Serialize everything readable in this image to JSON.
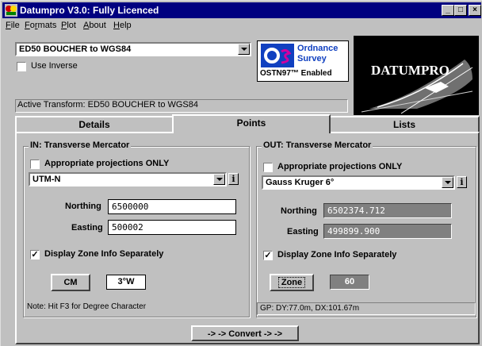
{
  "window": {
    "title": "Datumpro V3.0: Fully Licenced",
    "controls": {
      "minimize": "_",
      "maximize": "□",
      "close": "×"
    }
  },
  "menu": [
    "File",
    "Formats",
    "Plot",
    "About",
    "Help"
  ],
  "transform_select": {
    "value": "ED50 BOUCHER to WGS84"
  },
  "use_inverse": {
    "label": "Use Inverse",
    "checked": false
  },
  "os_logo": {
    "line1": "Ordnance",
    "line2": "Survey",
    "badge": "OSTN97™ Enabled",
    "colors": {
      "blue": "#1040c0",
      "magenta": "#d000a0"
    }
  },
  "datumpro_logo": {
    "text": "DATUMPRO"
  },
  "active_transform": "Active Transform: ED50 BOUCHER to WGS84",
  "tabs": [
    {
      "label": "Details",
      "active": false
    },
    {
      "label": "Points",
      "active": true
    },
    {
      "label": "Lists",
      "active": false
    }
  ],
  "input": {
    "group_title": "IN: Transverse Mercator",
    "appropriate_only": {
      "label": "Appropriate projections ONLY",
      "checked": false
    },
    "projection": "UTM-N",
    "info_button": "i",
    "northing": {
      "label": "Northing",
      "value": "6500000"
    },
    "easting": {
      "label": "Easting",
      "value": "500002"
    },
    "zone_separate": {
      "label": "Display  Zone Info Separately",
      "checked": true,
      "mark": "✓"
    },
    "cm_button": "CM",
    "cm_value": "3°W",
    "note": "Note: Hit F3 for Degree Character"
  },
  "output": {
    "group_title": "OUT: Transverse Mercator",
    "appropriate_only": {
      "label": "Appropriate projections ONLY",
      "checked": false
    },
    "projection": "Gauss Kruger 6°",
    "info_button": "i",
    "northing": {
      "label": "Northing",
      "value": "6502374.712"
    },
    "easting": {
      "label": "Easting",
      "value": "499899.900"
    },
    "zone_separate": {
      "label": "Display  Zone Info Separately",
      "checked": true,
      "mark": "✓"
    },
    "zone_button": "Zone",
    "zone_value": "60",
    "status": "GP: DY:77.0m, DX:101.67m"
  },
  "convert_button": "-> -> Convert -> ->"
}
